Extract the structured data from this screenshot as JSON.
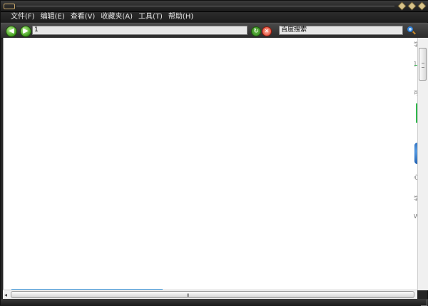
{
  "menu": {
    "items": [
      {
        "label": "文件(F)"
      },
      {
        "label": "编辑(E)"
      },
      {
        "label": "查看(V)"
      },
      {
        "label": "收藏夹(A)"
      },
      {
        "label": "工具(T)"
      },
      {
        "label": "帮助(H)"
      }
    ]
  },
  "toolbar": {
    "back_icon": "back-arrow-icon",
    "forward_icon": "forward-arrow-icon",
    "address_value": "1",
    "refresh_icon": "refresh-icon",
    "stop_icon": "stop-icon",
    "search_value": "百度搜索",
    "search_icon": "search-icon"
  },
  "content": {
    "peek_chars": [
      "学",
      "]",
      "可",
      "心",
      "学",
      "W"
    ]
  },
  "scroll": {
    "left_arrow": "◂",
    "grip": "III"
  },
  "colors": {
    "accent_green": "#2fb84c",
    "progress_blue": "#4aa3e8",
    "frame_dark": "#252525"
  }
}
